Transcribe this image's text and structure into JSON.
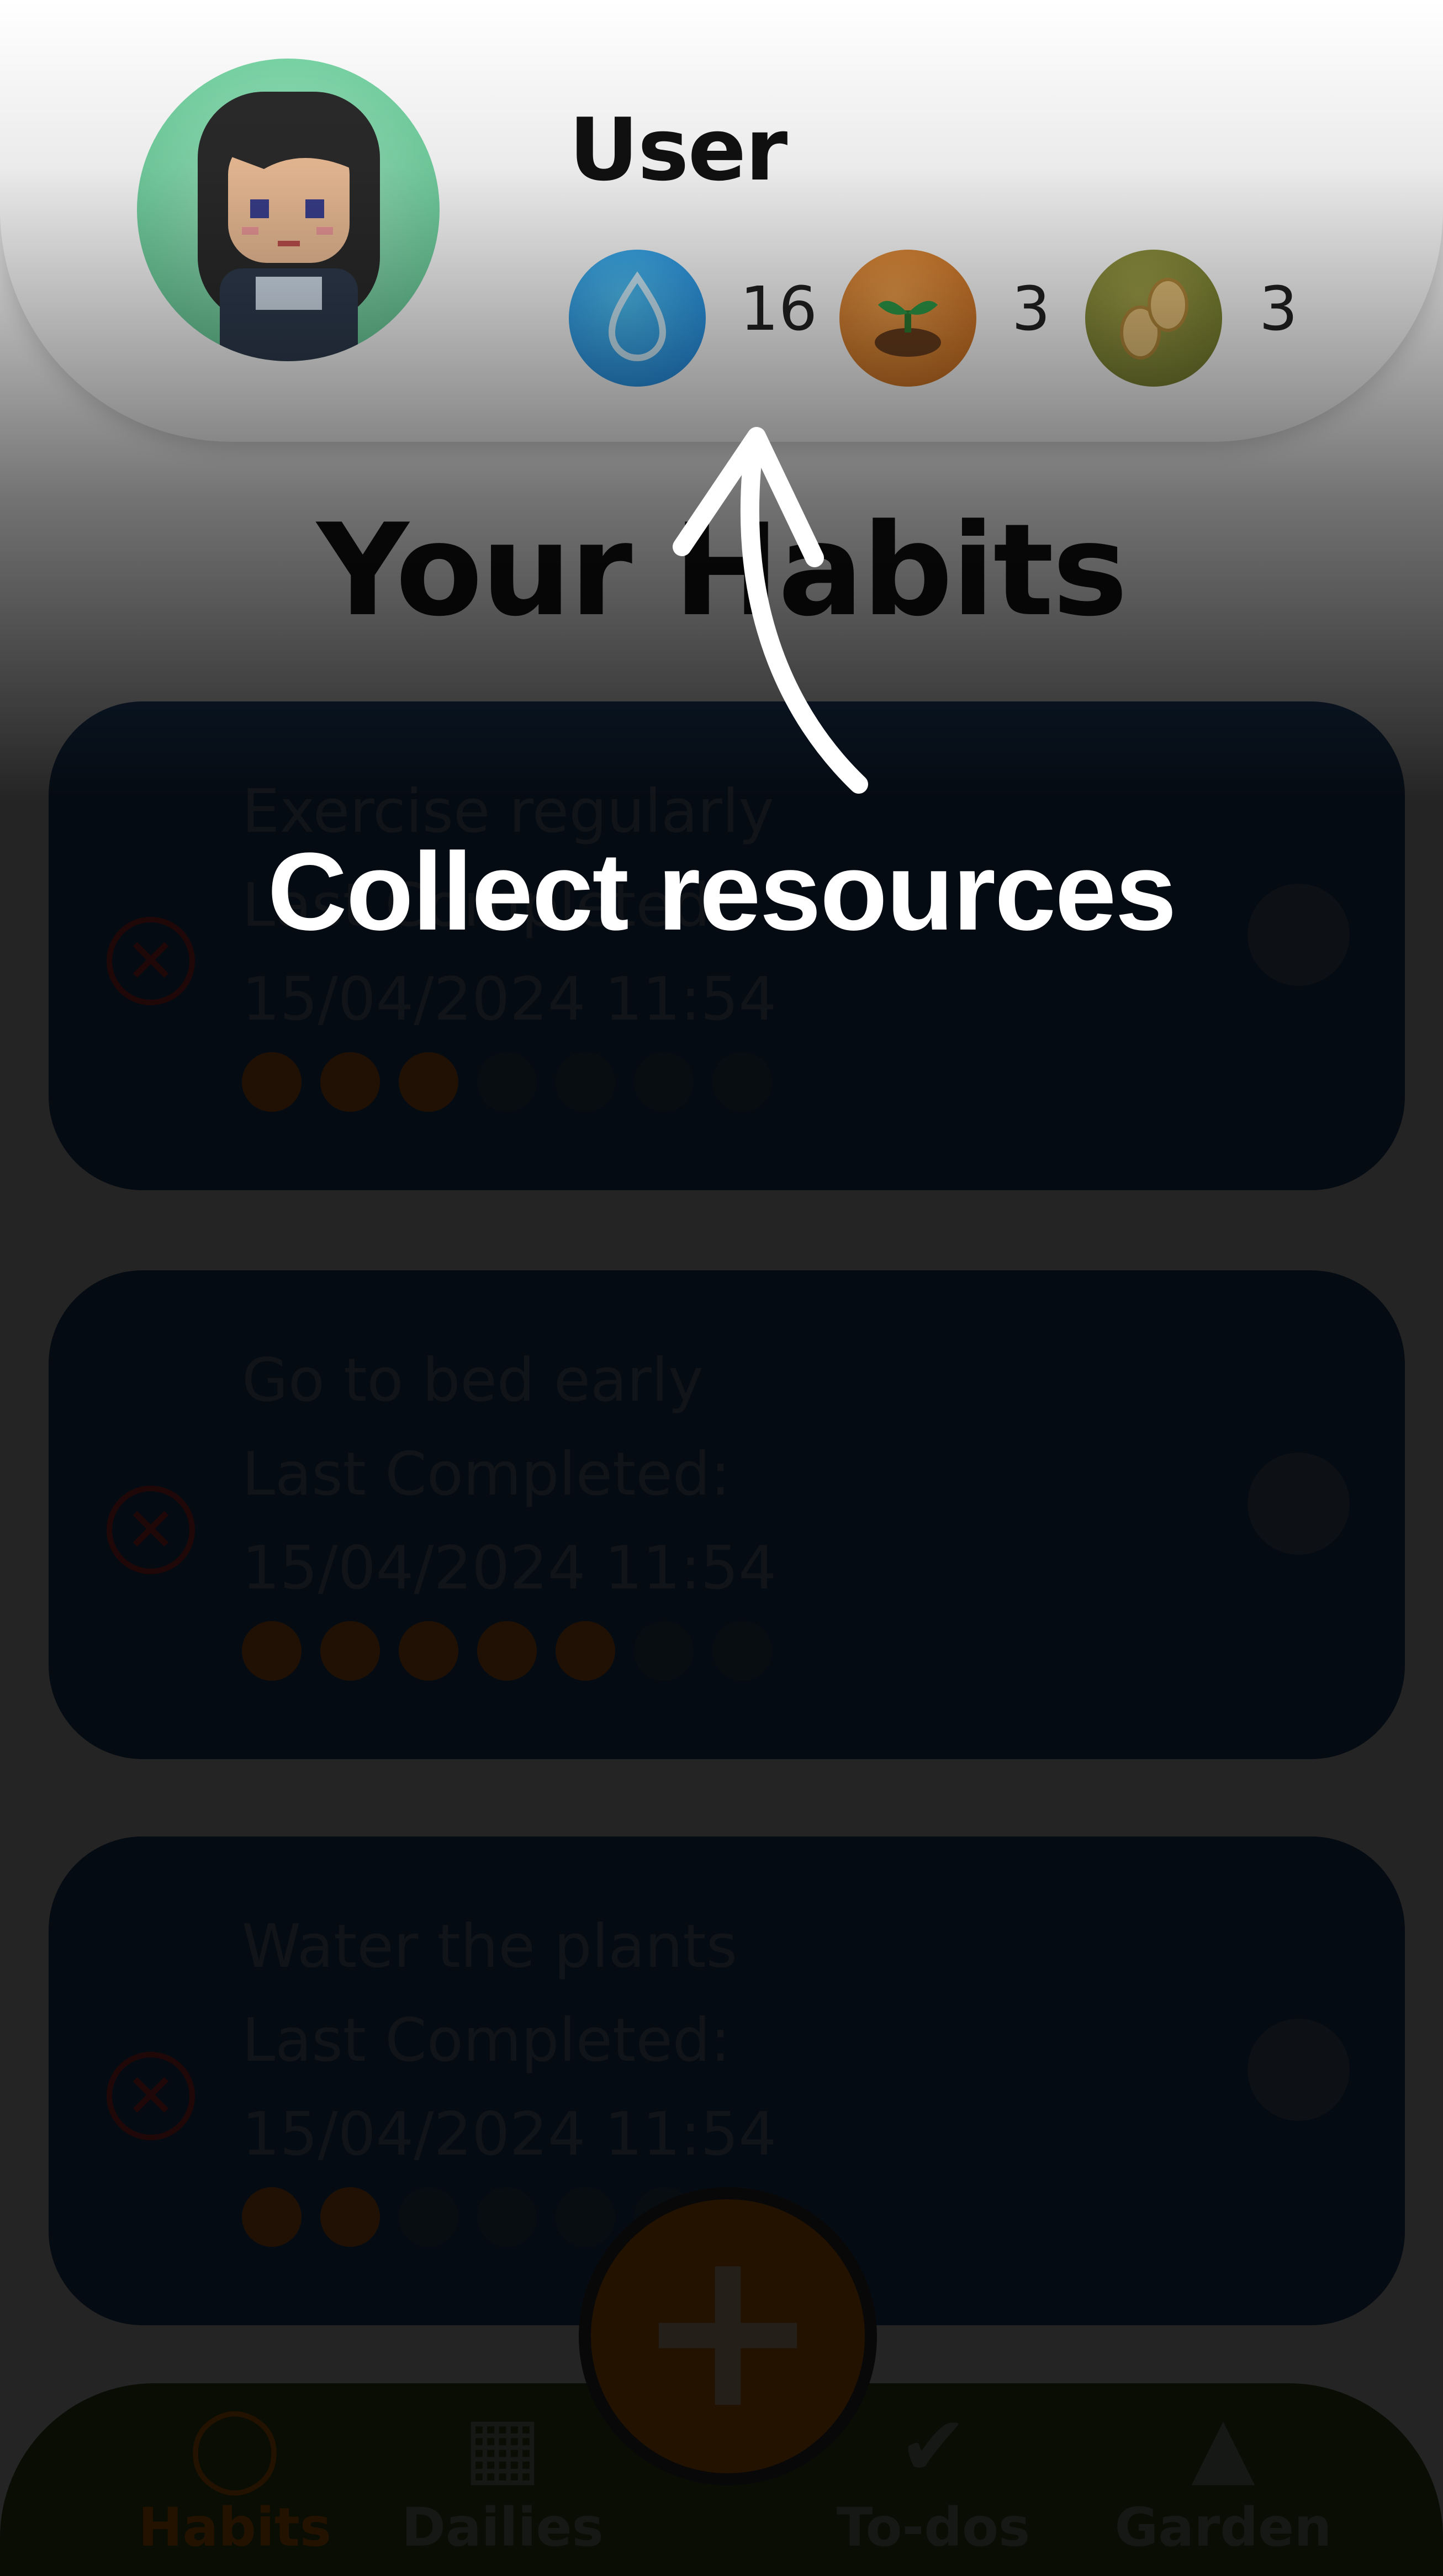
{
  "header": {
    "username": "User",
    "resources": [
      {
        "icon": "water-drop-icon",
        "count": "16"
      },
      {
        "icon": "sprout-icon",
        "count": "3"
      },
      {
        "icon": "seeds-icon",
        "count": "3"
      }
    ]
  },
  "main": {
    "title": "Your Habits",
    "habits": [
      {
        "name": "Exercise regularly",
        "last_label": "Last Completed:",
        "last": "15/04/2024 11:54",
        "streak": 3,
        "streak_max": 7
      },
      {
        "name": "Go to bed early",
        "last_label": "Last Completed:",
        "last": "15/04/2024 11:54",
        "streak": 5,
        "streak_max": 7
      },
      {
        "name": "Water the plants",
        "last_label": "Last Completed:",
        "last": "15/04/2024 11:54",
        "streak": 2,
        "streak_max": 7
      }
    ]
  },
  "nav": {
    "items": [
      {
        "label": "Habits",
        "icon": "ring-icon",
        "active": true
      },
      {
        "label": "Dailies",
        "icon": "calendar-check-icon",
        "active": false
      },
      {
        "label": "To-dos",
        "icon": "check-circle-icon",
        "active": false
      },
      {
        "label": "Garden",
        "icon": "tree-icon",
        "active": false
      }
    ],
    "add_icon": "plus-icon"
  },
  "onboarding": {
    "message": "Collect resources"
  },
  "colors": {
    "accent": "#f57c00",
    "card": "#244c7e",
    "nav": "#3e5a1e",
    "delete": "#e53935"
  }
}
